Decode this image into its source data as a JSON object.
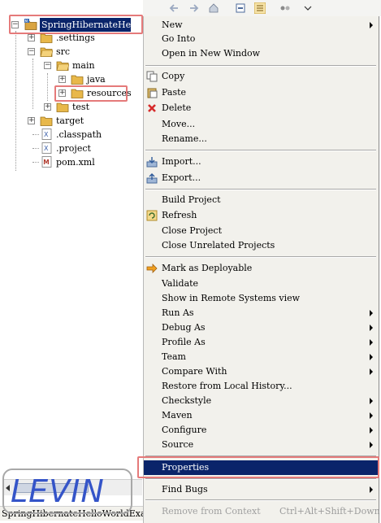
{
  "tree": {
    "project": "SpringHibernateHelloWorldExample",
    "items": [
      {
        "label": ".settings"
      },
      {
        "label": "src"
      },
      {
        "label": "main"
      },
      {
        "label": "java"
      },
      {
        "label": "resources"
      },
      {
        "label": "test"
      },
      {
        "label": "target"
      },
      {
        "label": ".classpath"
      },
      {
        "label": ".project"
      },
      {
        "label": "pom.xml"
      }
    ],
    "status_text": "SpringHibernateHelloWorldExample"
  },
  "watermark": "LEVIN",
  "menu": {
    "items": [
      {
        "label": "New"
      },
      {
        "label": "Go Into"
      },
      {
        "label": "Open in New Window"
      },
      {
        "label": "Copy"
      },
      {
        "label": "Paste"
      },
      {
        "label": "Delete"
      },
      {
        "label": "Move..."
      },
      {
        "label": "Rename..."
      },
      {
        "label": "Import..."
      },
      {
        "label": "Export..."
      },
      {
        "label": "Build Project"
      },
      {
        "label": "Refresh"
      },
      {
        "label": "Close Project"
      },
      {
        "label": "Close Unrelated Projects"
      },
      {
        "label": "Mark as Deployable"
      },
      {
        "label": "Validate"
      },
      {
        "label": "Show in Remote Systems view"
      },
      {
        "label": "Run As"
      },
      {
        "label": "Debug As"
      },
      {
        "label": "Profile As"
      },
      {
        "label": "Team"
      },
      {
        "label": "Compare With"
      },
      {
        "label": "Restore from Local History..."
      },
      {
        "label": "Checkstyle"
      },
      {
        "label": "Maven"
      },
      {
        "label": "Configure"
      },
      {
        "label": "Source"
      },
      {
        "label": "Properties"
      },
      {
        "label": "Find Bugs"
      },
      {
        "label": "Remove from Context",
        "shortcut": "Ctrl+Alt+Shift+Down"
      }
    ]
  },
  "colors": {
    "selection": "#0a246a",
    "highlight_box": "#e57a7a",
    "menu_bg": "#f2f1ec",
    "watermark": "#3454c8"
  }
}
